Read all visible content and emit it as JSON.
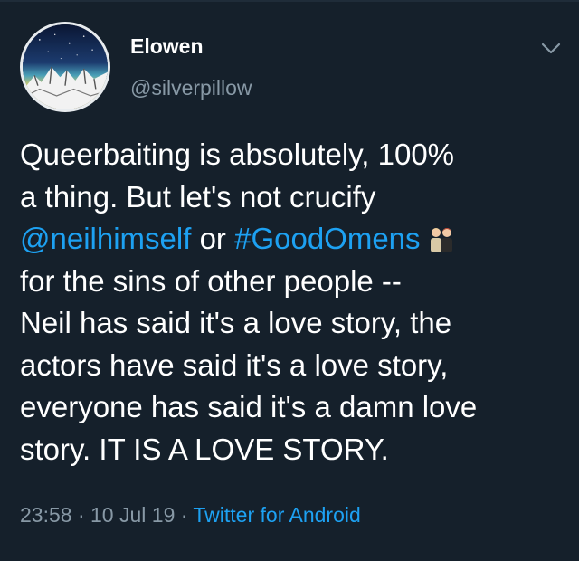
{
  "tweet": {
    "author": {
      "display_name": "Elowen",
      "handle": "@silverpillow",
      "avatar_icon": "mountain-night-sky-avatar"
    },
    "text": {
      "line1": "Queerbaiting is absolutely, 100%",
      "line2": "a thing. But let's not crucify",
      "line3_mention": "@neilhimself",
      "line3_or": " or ",
      "line3_hashtag": "#GoodOmens",
      "line3_emoji": "couple-emoji",
      "line4": "for the sins of other people --",
      "line5": "Neil has said it's a love story, the",
      "line6": "actors have said it's a love story,",
      "line7": "everyone has said it's a damn love",
      "line8": "story. IT IS A LOVE STORY."
    },
    "meta": {
      "time": "23:58",
      "separator1": " · ",
      "date": "10 Jul 19",
      "separator2": " · ",
      "source": "Twitter for Android"
    },
    "menu_icon": "chevron-down-icon"
  },
  "colors": {
    "background": "#15202b",
    "text": "#ffffff",
    "secondary": "#8899a6",
    "link": "#1da1f2"
  }
}
